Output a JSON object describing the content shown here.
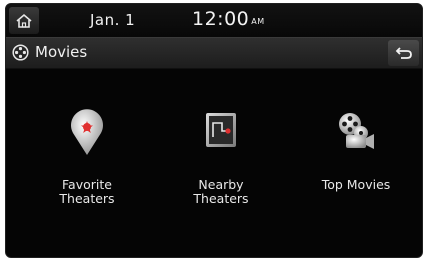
{
  "status_bar": {
    "home_icon": "home-icon",
    "date": "Jan.  1",
    "time": "12:00",
    "ampm": "AM"
  },
  "title_bar": {
    "icon": "film-reel-icon",
    "title": "Movies",
    "back_icon": "back-arrow-icon"
  },
  "menu": [
    {
      "label_line1": "Favorite",
      "label_line2": "Theaters",
      "icon": "favorite-pin-icon",
      "accent": "#e03030"
    },
    {
      "label_line1": "Nearby",
      "label_line2": "Theaters",
      "icon": "nearby-map-icon",
      "accent": "#e03030"
    },
    {
      "label_line1": "Top Movies",
      "label_line2": "",
      "icon": "film-camera-icon",
      "accent": "#e0e0e0"
    }
  ]
}
